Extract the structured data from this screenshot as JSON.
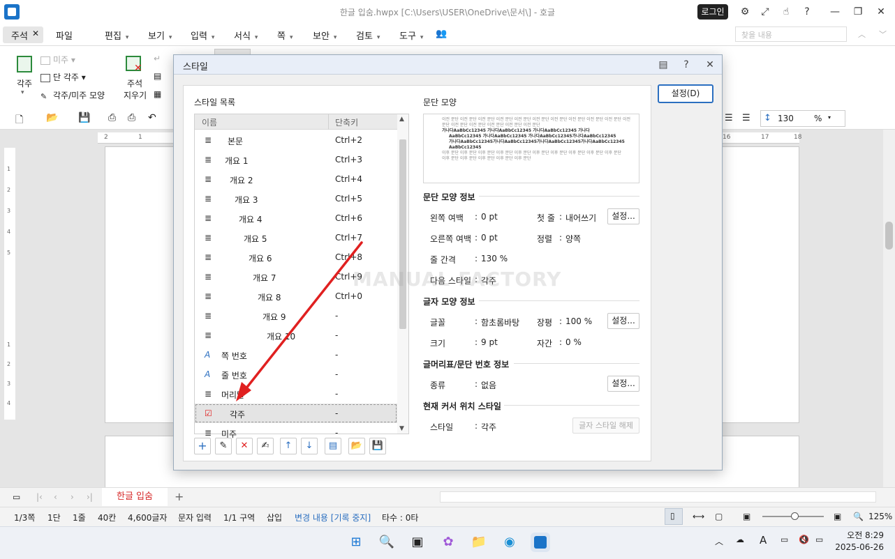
{
  "window": {
    "title": "한글 입숨.hwpx [C:\\Users\\USER\\OneDrive\\문서\\] - 호글",
    "login": "로그인"
  },
  "menu": {
    "active_tab": "주석",
    "items": [
      "파일",
      "편집",
      "보기",
      "입력",
      "서식",
      "쪽",
      "보안",
      "검토",
      "도구"
    ],
    "search_placeholder": "찾을 내용"
  },
  "ribbon": {
    "footnote": "각주",
    "endnote": "미주",
    "footnote_single": "단 각주",
    "footnote_shape": "각주/미주 모양",
    "delete_comment_1": "주석",
    "delete_comment_2": "지우기",
    "line_spacing": "130",
    "line_unit": "%"
  },
  "ruler": {
    "top_ticks": [
      "2",
      "1",
      "16",
      "17",
      "18"
    ],
    "left_ticks": [
      "1",
      "2",
      "3",
      "4",
      "5",
      "1",
      "2",
      "3",
      "4"
    ]
  },
  "dialog": {
    "title": "스타일",
    "settings_button": "설정(D)",
    "list_label": "스타일 목록",
    "col_name": "이름",
    "col_shortcut": "단축키",
    "styles": [
      {
        "name": "본문",
        "shortcut": "Ctrl+2",
        "icon": "para-icon"
      },
      {
        "name": "개요 1",
        "shortcut": "Ctrl+3",
        "icon": "para-icon"
      },
      {
        "name": "개요 2",
        "shortcut": "Ctrl+4",
        "icon": "para-icon"
      },
      {
        "name": "개요 3",
        "shortcut": "Ctrl+5",
        "icon": "para-icon"
      },
      {
        "name": "개요 4",
        "shortcut": "Ctrl+6",
        "icon": "para-icon"
      },
      {
        "name": "개요 5",
        "shortcut": "Ctrl+7",
        "icon": "para-icon"
      },
      {
        "name": "개요 6",
        "shortcut": "Ctrl+8",
        "icon": "para-icon"
      },
      {
        "name": "개요 7",
        "shortcut": "Ctrl+9",
        "icon": "para-icon"
      },
      {
        "name": "개요 8",
        "shortcut": "Ctrl+0",
        "icon": "para-icon"
      },
      {
        "name": "개요 9",
        "shortcut": "-",
        "icon": "para-icon"
      },
      {
        "name": "개요 10",
        "shortcut": "-",
        "icon": "para-icon"
      },
      {
        "name": "쪽 번호",
        "shortcut": "-",
        "icon": "char-style-icon"
      },
      {
        "name": "줄 번호",
        "shortcut": "-",
        "icon": "char-style-icon"
      },
      {
        "name": "머리말",
        "shortcut": "-",
        "icon": "para-icon"
      },
      {
        "name": "각주",
        "shortcut": "-",
        "icon": "check-icon",
        "selected": true
      },
      {
        "name": "미주",
        "shortcut": "-",
        "icon": "para-icon"
      }
    ],
    "para_shape_label": "문단 모양",
    "preview_lines": [
      "이전 문단 이전 문단 이전 문단 이전 문단 이전 문단 이전 문단 이전 문단 이전 문단 이전 문단 이전 문단 이전",
      "문단 이전 문단 이전 문단 이전 문단 이전 문단 이전 문단",
      "가나다AaBbCc12345 가나다AaBbCc12345 가나다AaBbCc12345 가나다",
      "AaBbCc12345 가나다AaBbCc12345 가나다AaBbCc12345가나다AaBbCc12345",
      "가나다AaBbCc12345가나다AaBbCc12345가나다AaBbCc12345가나다AaBbCc12345",
      "AaBbCc12345",
      "이후 문단 이후 문단 이후 문단 이후 문단 이후 문단 이후 문단 이후 문단 이후 문단 이후 문단 이후 문단",
      "이후 문단 이후 문단 이후 문단 이후 문단 이후 문단"
    ],
    "para_info": {
      "title": "문단 모양 정보",
      "left_margin_label": "왼쪽 여백",
      "left_margin": "0 pt",
      "first_line_label": "첫 줄",
      "first_line": "내어쓰기",
      "right_margin_label": "오른쪽 여백",
      "right_margin": "0 pt",
      "align_label": "정렬",
      "align": "양쪽",
      "line_spacing_label": "줄 간격",
      "line_spacing": "130 %",
      "next_style_label": "다음 스타일",
      "next_style": "각주",
      "button": "설정..."
    },
    "char_info": {
      "title": "글자 모양 정보",
      "font_label": "글꼴",
      "font": "함초롬바탕",
      "width_label": "장평",
      "width": "100 %",
      "size_label": "크기",
      "size": "9 pt",
      "spacing_label": "자간",
      "spacing": "0 %",
      "button": "설정..."
    },
    "numbering_info": {
      "title": "글머리표/문단 번호 정보",
      "type_label": "종류",
      "type": "없음",
      "button": "설정..."
    },
    "cursor_info": {
      "title": "현재 커서 위치 스타일",
      "style_label": "스타일",
      "style": "각주",
      "release_button": "글자 스타일 해제"
    }
  },
  "watermark": "MANUAL FACTORY",
  "tabs": {
    "doc_tab": "한글 입숨"
  },
  "status": {
    "page": "1/3쪽",
    "column": "1단",
    "line": "1줄",
    "col": "40칸",
    "chars": "4,600글자",
    "input_mode": "문자 입력",
    "section": "1/1 구역",
    "insert": "삽입",
    "track": "변경 내용 [기록 중지]",
    "typing": "타수 : 0타",
    "zoom": "125%"
  },
  "taskbar": {
    "time": "오전 8:29",
    "date": "2025-06-26"
  },
  "colors": {
    "accent": "#2b6fc0",
    "doc_tab": "#d62828",
    "arrow": "#e02020"
  }
}
